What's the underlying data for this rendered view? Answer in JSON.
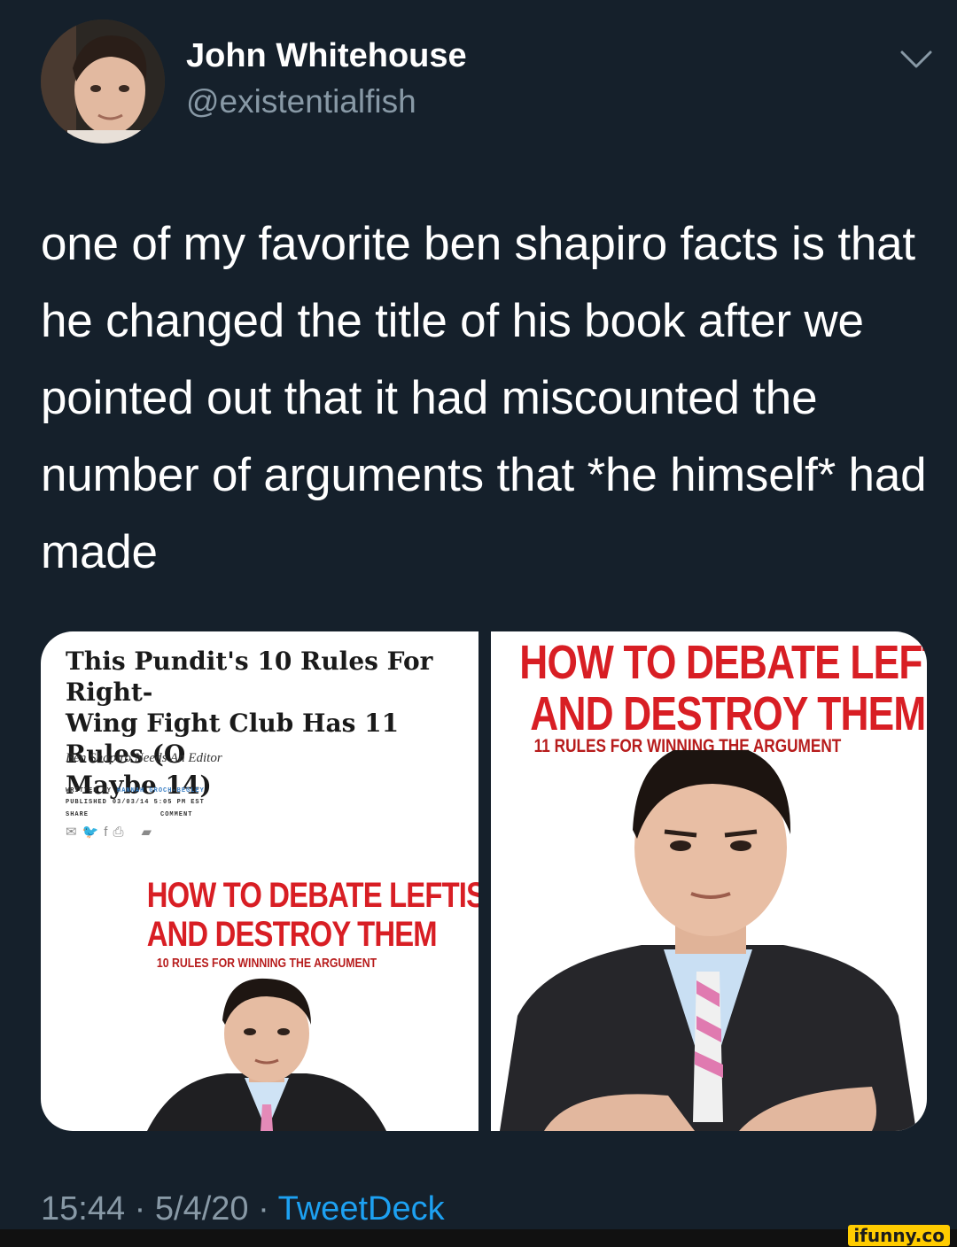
{
  "author": {
    "name": "John Whitehouse",
    "handle": "@existentialfish"
  },
  "icons": {
    "menu": "chevron-down-icon",
    "share_row": [
      "mail-icon",
      "twitter-icon",
      "facebook-icon",
      "print-icon",
      "comment-icon"
    ]
  },
  "tweet": {
    "text": "one of my favorite ben shapiro facts is that he changed the title of his book after we pointed out that it had miscounted the number of arguments that *he himself* had made"
  },
  "media": {
    "left": {
      "headline": "This Pundit's 10 Rules For Right-\nWing Fight Club Has 11 Rules (O\nMaybe 14)",
      "dek": "Ben Shapiro Needs An Editor",
      "written_by_label": "WRITTEN BY",
      "written_by_value": "HANNAH GROCH-BEGLEY",
      "published_label": "PUBLISHED",
      "published_value": "03/03/14 5:05 PM EST",
      "share_label": "SHARE",
      "comment_label": "COMMENT",
      "cover": {
        "line1": "HOW TO DEBATE LEFTISTS",
        "line2": "AND DESTROY THEM",
        "subtitle": "10 RULES FOR WINNING THE ARGUMENT"
      }
    },
    "right": {
      "cover": {
        "line1": "HOW TO DEBATE LEFTISTS",
        "line2": "AND DESTROY THEM",
        "subtitle": "11 RULES FOR WINNING THE ARGUMENT"
      }
    }
  },
  "meta": {
    "time": "15:44",
    "date": "5/4/20",
    "separator": "·",
    "source": "TweetDeck"
  },
  "watermark": "ifunny.co",
  "colors": {
    "background": "#15202b",
    "secondary_text": "#8899a6",
    "link": "#1da1f2",
    "cover_red": "#d81e24"
  }
}
